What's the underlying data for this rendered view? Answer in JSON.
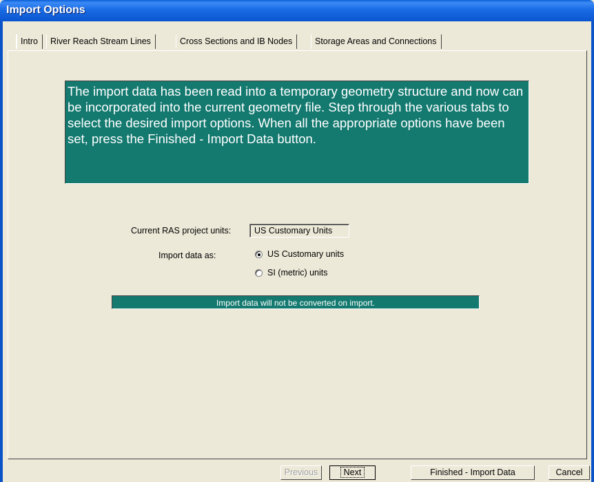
{
  "window": {
    "title": "Import Options"
  },
  "tabs": [
    {
      "label": "Intro"
    },
    {
      "label": "River Reach Stream Lines"
    },
    {
      "label": "Cross Sections and IB Nodes"
    },
    {
      "label": "Storage Areas and Connections"
    }
  ],
  "intro": {
    "message": "The import data has been read into a temporary geometry structure and now can be incorporated into the current geometry file.  Step through the various tabs to select the desired import options.  When all the appropriate options have been set, press the Finished - Import Data button."
  },
  "units": {
    "current_label": "Current RAS project units:",
    "current_value": "US Customary Units",
    "import_label": "Import data as:",
    "options": [
      {
        "label": "US Customary units",
        "selected": true
      },
      {
        "label": "SI (metric) units",
        "selected": false
      }
    ]
  },
  "status": {
    "text": "Import data will not be converted on import."
  },
  "buttons": {
    "previous": "Previous",
    "next": "Next",
    "finished": "Finished - Import Data",
    "cancel": "Cancel"
  },
  "colors": {
    "title_bar": "#0a5fd8",
    "panel_bg": "#ece9d8",
    "info_bg": "#147a70",
    "info_text": "#ffffff"
  }
}
